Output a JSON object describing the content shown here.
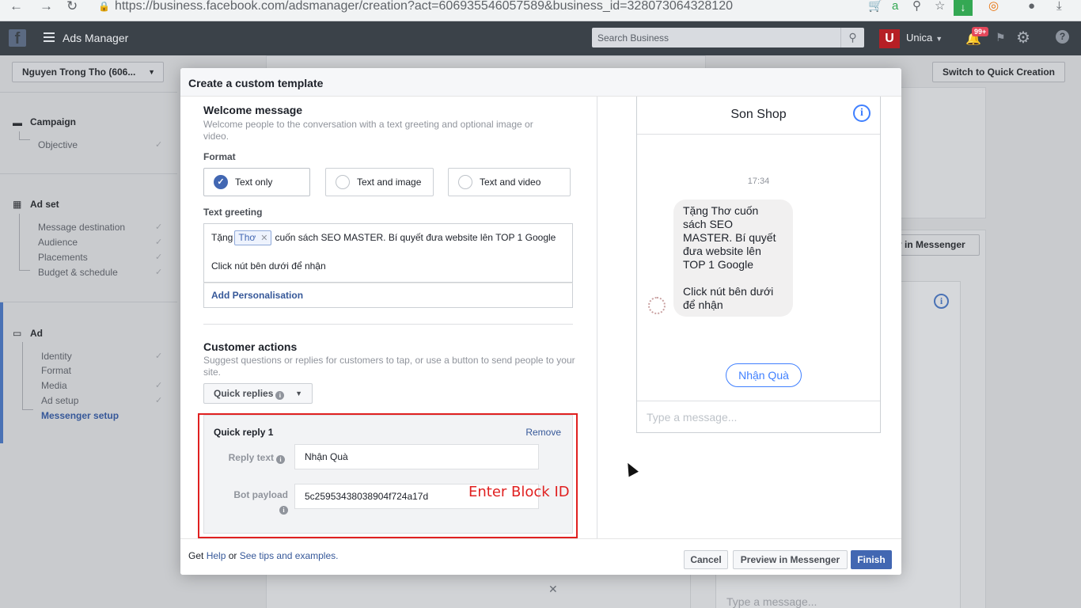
{
  "browser": {
    "url": "https://business.facebook.com/adsmanager/creation?act=606935546057589&business_id=328073064328120"
  },
  "topbar": {
    "app_title": "Ads Manager",
    "search_placeholder": "Search Business",
    "user_name": "Unica",
    "avatar_letter": "U",
    "notif_count": "99+"
  },
  "sidebar": {
    "account": "Nguyen Trong Tho (606...",
    "sections": [
      {
        "title": "Campaign",
        "items": [
          "Objective"
        ]
      },
      {
        "title": "Ad set",
        "items": [
          "Message destination",
          "Audience",
          "Placements",
          "Budget & schedule"
        ]
      },
      {
        "title": "Ad",
        "items": [
          "Identity",
          "Format",
          "Media",
          "Ad setup",
          "Messenger setup"
        ]
      }
    ]
  },
  "background": {
    "switch_label": "Switch to Quick Creation",
    "preview_label": "v in Messenger",
    "type_placeholder": "Type a message..."
  },
  "modal": {
    "title": "Create a custom template",
    "welcome": {
      "title": "Welcome message",
      "desc": "Welcome people to the conversation with a text greeting and optional image or video.",
      "format_label": "Format",
      "formats": [
        "Text only",
        "Text and image",
        "Text and video"
      ],
      "selected_format": "Text only",
      "greeting_label": "Text greeting",
      "greeting_prefix": "Tặng",
      "token": "Thơ",
      "greeting_rest": "cuốn sách SEO MASTER. Bí quyết đưa website lên TOP 1 Google",
      "greeting_line2": "Click nút bên dưới để nhận",
      "add_personalisation": "Add Personalisation"
    },
    "customer_actions": {
      "title": "Customer actions",
      "desc": "Suggest questions or replies for customers to tap, or use a button to send people to your site.",
      "select_value": "Quick replies",
      "quick_reply": {
        "title": "Quick reply 1",
        "remove": "Remove",
        "reply_text_label": "Reply text",
        "reply_text_value": "Nhận Quà",
        "payload_label": "Bot payload",
        "payload_value": "5c25953438038904f724a17d",
        "annotation": "Enter Block ID"
      }
    },
    "preview": {
      "page_name": "Son Shop",
      "time": "17:34",
      "message_line1": "Tặng Thơ  cuốn sách SEO MASTER. Bí quyết đưa website lên TOP 1 Google",
      "message_line2": "Click nút bên dưới để nhận",
      "quick_reply_chip": "Nhận Quà",
      "input_placeholder": "Type a message..."
    },
    "footer": {
      "get": "Get",
      "help": "Help",
      "or": "or",
      "tips": "See tips and examples.",
      "cancel": "Cancel",
      "preview": "Preview in Messenger",
      "finish": "Finish"
    }
  }
}
